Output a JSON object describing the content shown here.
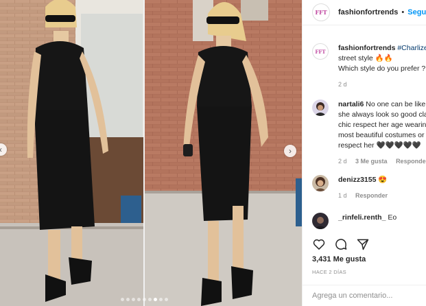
{
  "post": {
    "carousel": {
      "slide_count": 9,
      "active_slide": 7
    },
    "prev_label": "‹",
    "next_label": "›"
  },
  "header": {
    "avatar_text": "FFT",
    "username": "fashionfortrends",
    "separator": "•",
    "follow_label": "Seguir"
  },
  "caption": {
    "username": "fashionfortrends",
    "hashtag": "#Charlize",
    "line2": "street style 🔥🔥",
    "line3": "Which style do you prefer ?",
    "time": "2 d"
  },
  "comments": [
    {
      "username": "nartali6",
      "lines": [
        "No one can be like",
        "she always look so good cla",
        "chic respect her age wearin",
        "most beautiful costumes or",
        "respect her 🖤🖤🖤🖤🖤"
      ],
      "time": "2 d",
      "likes": "3 Me gusta",
      "reply": "Responder"
    },
    {
      "username": "denizz3155",
      "text": "😍",
      "time": "1 d",
      "reply": "Responder"
    },
    {
      "username": "_rinfeli.renth_",
      "text": "Eo"
    }
  ],
  "stats": {
    "likes": "3,431 Me gusta",
    "posted": "HACE 2 DÍAS"
  },
  "comment_input": {
    "placeholder": "Agrega un comentario..."
  },
  "colors": {
    "link_blue": "#0095f6",
    "hashtag_blue": "#00376b",
    "muted": "#8e8e8e",
    "brand_pink": "#c04aa2"
  }
}
